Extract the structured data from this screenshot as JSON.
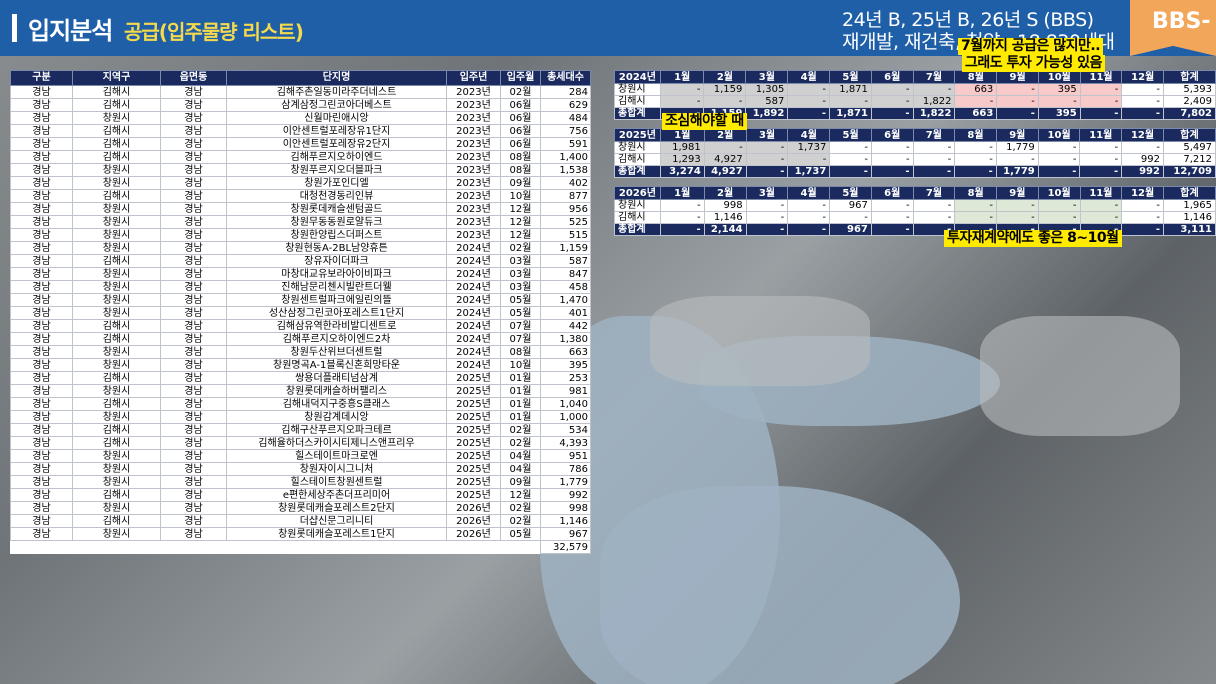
{
  "header": {
    "title": "입지분석",
    "subtitle": "공급(입주물량 리스트)",
    "right_line1": "24년 B, 25년 B, 26년 S (BBS)",
    "right_line2": "재개발, 재건축, 청약 : 18,830세대",
    "badge": "BBS-"
  },
  "notes": {
    "n1": "7월까지 공급은 많지만..",
    "n2": "그래도 투자 가능성 있음",
    "n3": "조심해야할 때",
    "n4": "투자재계약에도 좋은 8~10월"
  },
  "list": {
    "columns": [
      "구분",
      "지역구",
      "읍면동",
      "단지명",
      "입주년",
      "입주월",
      "총세대수"
    ],
    "rows": [
      [
        "경남",
        "김해시",
        "경남",
        "김해주촌일동미라주더네스트",
        "2023년",
        "02월",
        "284"
      ],
      [
        "경남",
        "김해시",
        "경남",
        "삼계삼정그린코아더베스트",
        "2023년",
        "06월",
        "629"
      ],
      [
        "경남",
        "창원시",
        "경남",
        "신월마린애시앙",
        "2023년",
        "06월",
        "484"
      ],
      [
        "경남",
        "김해시",
        "경남",
        "이안센트럴포레장유1단지",
        "2023년",
        "06월",
        "756"
      ],
      [
        "경남",
        "김해시",
        "경남",
        "이안센트럴포레장유2단지",
        "2023년",
        "06월",
        "591"
      ],
      [
        "경남",
        "김해시",
        "경남",
        "김해푸르지오하이엔드",
        "2023년",
        "08월",
        "1,400"
      ],
      [
        "경남",
        "창원시",
        "경남",
        "창원푸르지오더블파크",
        "2023년",
        "08월",
        "1,538"
      ],
      [
        "경남",
        "창원시",
        "경남",
        "창원가포인디엘",
        "2023년",
        "09월",
        "402"
      ],
      [
        "경남",
        "김해시",
        "경남",
        "대청천경동리인뷰",
        "2023년",
        "10월",
        "877"
      ],
      [
        "경남",
        "창원시",
        "경남",
        "창원롯데캐슬센텀골드",
        "2023년",
        "12월",
        "956"
      ],
      [
        "경남",
        "창원시",
        "경남",
        "창원무동동원로얄듀크",
        "2023년",
        "12월",
        "525"
      ],
      [
        "경남",
        "창원시",
        "경남",
        "창원한양립스더퍼스트",
        "2023년",
        "12월",
        "515"
      ],
      [
        "경남",
        "창원시",
        "경남",
        "창원현동A-2BL남양휴튼",
        "2024년",
        "02월",
        "1,159"
      ],
      [
        "경남",
        "김해시",
        "경남",
        "장유자이더파크",
        "2024년",
        "03월",
        "587"
      ],
      [
        "경남",
        "창원시",
        "경남",
        "마창대교유보라아이비파크",
        "2024년",
        "03월",
        "847"
      ],
      [
        "경남",
        "창원시",
        "경남",
        "진해남문리첸시빌란트더웰",
        "2024년",
        "03월",
        "458"
      ],
      [
        "경남",
        "창원시",
        "경남",
        "창원센트럴파크에일린의뜰",
        "2024년",
        "05월",
        "1,470"
      ],
      [
        "경남",
        "창원시",
        "경남",
        "성산삼정그린코아포레스트1단지",
        "2024년",
        "05월",
        "401"
      ],
      [
        "경남",
        "김해시",
        "경남",
        "김해삼유역한라비발디센트로",
        "2024년",
        "07월",
        "442"
      ],
      [
        "경남",
        "김해시",
        "경남",
        "김해푸르지오하이엔드2차",
        "2024년",
        "07월",
        "1,380"
      ],
      [
        "경남",
        "창원시",
        "경남",
        "창원두산위브더센트럴",
        "2024년",
        "08월",
        "663"
      ],
      [
        "경남",
        "창원시",
        "경남",
        "창원명곡A-1블록신혼희망타운",
        "2024년",
        "10월",
        "395"
      ],
      [
        "경남",
        "김해시",
        "경남",
        "쌍용더플래티넘삼계",
        "2025년",
        "01월",
        "253"
      ],
      [
        "경남",
        "창원시",
        "경남",
        "창원롯데캐슬하버팰리스",
        "2025년",
        "01월",
        "981"
      ],
      [
        "경남",
        "김해시",
        "경남",
        "김해내덕지구중흥S클래스",
        "2025년",
        "01월",
        "1,040"
      ],
      [
        "경남",
        "창원시",
        "경남",
        "창원감계데시앙",
        "2025년",
        "01월",
        "1,000"
      ],
      [
        "경남",
        "김해시",
        "경남",
        "김해구산푸르지오파크테르",
        "2025년",
        "02월",
        "534"
      ],
      [
        "경남",
        "김해시",
        "경남",
        "김해율하더스카이시티제니스앤프리우",
        "2025년",
        "02월",
        "4,393"
      ],
      [
        "경남",
        "창원시",
        "경남",
        "힐스테이트마크로엔",
        "2025년",
        "04월",
        "951"
      ],
      [
        "경남",
        "창원시",
        "경남",
        "창원자이시그니처",
        "2025년",
        "04월",
        "786"
      ],
      [
        "경남",
        "창원시",
        "경남",
        "힐스테이트창원센트럴",
        "2025년",
        "09월",
        "1,779"
      ],
      [
        "경남",
        "김해시",
        "경남",
        "e편한세상주촌더프리미어",
        "2025년",
        "12월",
        "992"
      ],
      [
        "경남",
        "창원시",
        "경남",
        "창원롯데캐슬포레스트2단지",
        "2026년",
        "02월",
        "998"
      ],
      [
        "경남",
        "김해시",
        "경남",
        "더샵신문그리니티",
        "2026년",
        "02월",
        "1,146"
      ],
      [
        "경남",
        "창원시",
        "경남",
        "창원롯데캐슬포레스트1단지",
        "2026년",
        "05월",
        "967"
      ]
    ],
    "total": "32,579"
  },
  "summary": {
    "months": [
      "1월",
      "2월",
      "3월",
      "4월",
      "5월",
      "6월",
      "7월",
      "8월",
      "9월",
      "10월",
      "11월",
      "12월",
      "합계"
    ],
    "tables": [
      {
        "year": "2024년",
        "rows": [
          {
            "label": "창원시",
            "cells": [
              "-",
              "1,159",
              "1,305",
              "-",
              "1,871",
              "-",
              "-",
              "663",
              "-",
              "395",
              "-",
              "-",
              "5,393"
            ]
          },
          {
            "label": "김해시",
            "cells": [
              "-",
              "-",
              "587",
              "-",
              "-",
              "-",
              "1,822",
              "-",
              "-",
              "-",
              "-",
              "-",
              "2,409"
            ]
          }
        ],
        "sum": {
          "label": "총합계",
          "cells": [
            "-",
            "1,159",
            "1,892",
            "-",
            "1,871",
            "-",
            "1,822",
            "663",
            "-",
            "395",
            "-",
            "-",
            "7,802"
          ]
        }
      },
      {
        "year": "2025년",
        "rows": [
          {
            "label": "창원시",
            "cells": [
              "1,981",
              "-",
              "-",
              "1,737",
              "-",
              "-",
              "-",
              "-",
              "1,779",
              "-",
              "-",
              "-",
              "5,497"
            ]
          },
          {
            "label": "김해시",
            "cells": [
              "1,293",
              "4,927",
              "-",
              "-",
              "-",
              "-",
              "-",
              "-",
              "-",
              "-",
              "-",
              "992",
              "7,212"
            ]
          }
        ],
        "sum": {
          "label": "총합계",
          "cells": [
            "3,274",
            "4,927",
            "-",
            "1,737",
            "-",
            "-",
            "-",
            "-",
            "1,779",
            "-",
            "-",
            "992",
            "12,709"
          ]
        }
      },
      {
        "year": "2026년",
        "rows": [
          {
            "label": "창원시",
            "cells": [
              "-",
              "998",
              "-",
              "-",
              "967",
              "-",
              "-",
              "-",
              "-",
              "-",
              "-",
              "-",
              "1,965"
            ]
          },
          {
            "label": "김해시",
            "cells": [
              "-",
              "1,146",
              "-",
              "-",
              "-",
              "-",
              "-",
              "-",
              "-",
              "-",
              "-",
              "-",
              "1,146"
            ]
          }
        ],
        "sum": {
          "label": "총합계",
          "cells": [
            "-",
            "2,144",
            "-",
            "-",
            "967",
            "-",
            "-",
            "-",
            "-",
            "-",
            "-",
            "-",
            "3,111"
          ]
        }
      }
    ]
  }
}
